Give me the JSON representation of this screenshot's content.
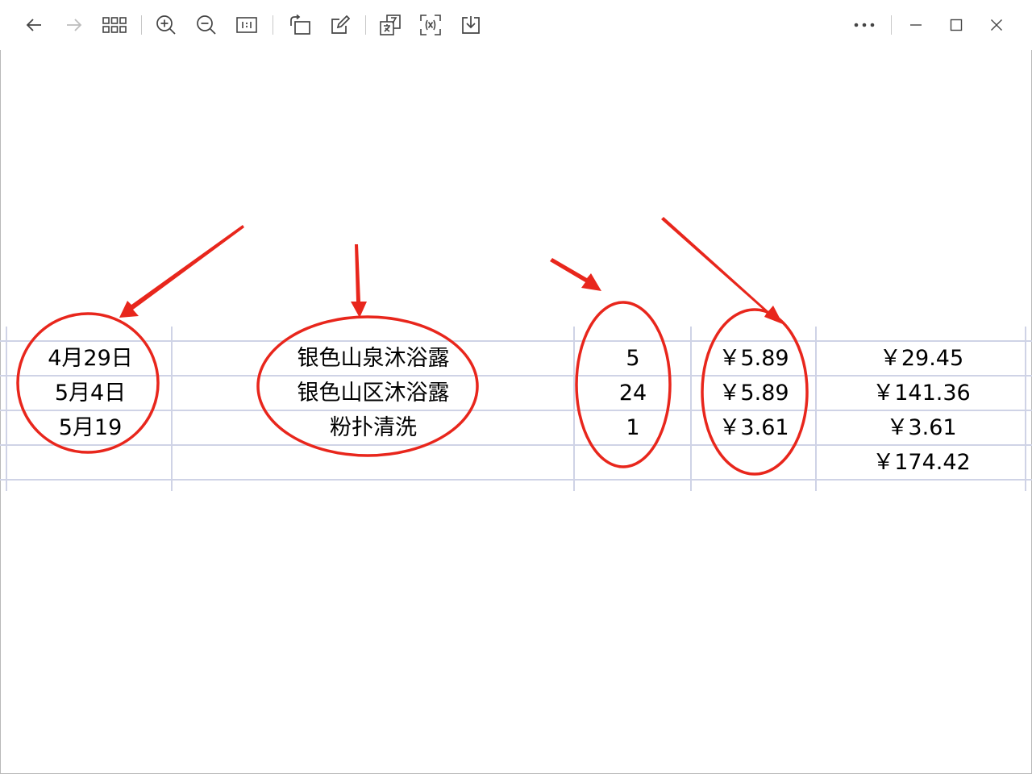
{
  "toolbar": {
    "buttons": [
      {
        "name": "back-button",
        "icon": "arrow-left-icon"
      },
      {
        "name": "forward-button",
        "icon": "arrow-right-icon"
      },
      {
        "name": "grid-view-button",
        "icon": "grid-icon"
      },
      {
        "name": "zoom-in-button",
        "icon": "zoom-in-icon"
      },
      {
        "name": "zoom-out-button",
        "icon": "zoom-out-icon"
      },
      {
        "name": "actual-size-button",
        "icon": "actual-size-icon"
      },
      {
        "name": "rotate-button",
        "icon": "rotate-icon"
      },
      {
        "name": "edit-button",
        "icon": "edit-icon"
      },
      {
        "name": "translate-button",
        "icon": "translate-icon"
      },
      {
        "name": "extract-text-button",
        "icon": "text-scan-icon"
      },
      {
        "name": "save-button",
        "icon": "download-icon"
      }
    ],
    "window": {
      "more_icon": "more-dots-icon",
      "minimize_icon": "minimize-icon",
      "maximize_icon": "maximize-icon",
      "close_icon": "close-icon"
    }
  },
  "table": {
    "rows": [
      {
        "date": "4月29日",
        "name": "银色山泉沐浴露",
        "qty": "5",
        "price": "￥5.89",
        "total": "￥29.45"
      },
      {
        "date": "5月4日",
        "name": "银色山区沐浴露",
        "qty": "24",
        "price": "￥5.89",
        "total": "￥141.36"
      },
      {
        "date": "5月19",
        "name": "粉扑清洗",
        "qty": "1",
        "price": "￥3.61",
        "total": "￥3.61"
      },
      {
        "date": "",
        "name": "",
        "qty": "",
        "price": "",
        "total": "￥174.42"
      }
    ]
  },
  "colors": {
    "annotation": "#e8261c",
    "grid": "#cfd3e6",
    "icon": "#444444",
    "icon_disabled": "#bdbdbd"
  }
}
